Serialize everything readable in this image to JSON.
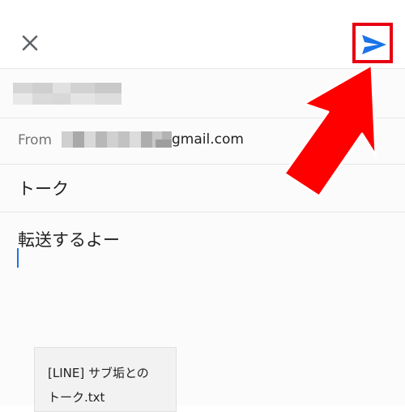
{
  "header": {
    "close_icon": "close-icon",
    "send_icon": "send-icon"
  },
  "from": {
    "label": "From",
    "value_suffix": "gmail.com"
  },
  "subject": "トーク",
  "body": "転送するよー",
  "attachment": {
    "name_line1": "[LINE] サブ垢との",
    "name_line2": "トーク.txt"
  },
  "colors": {
    "accent": "#1a73e8",
    "highlight": "#e60012"
  }
}
